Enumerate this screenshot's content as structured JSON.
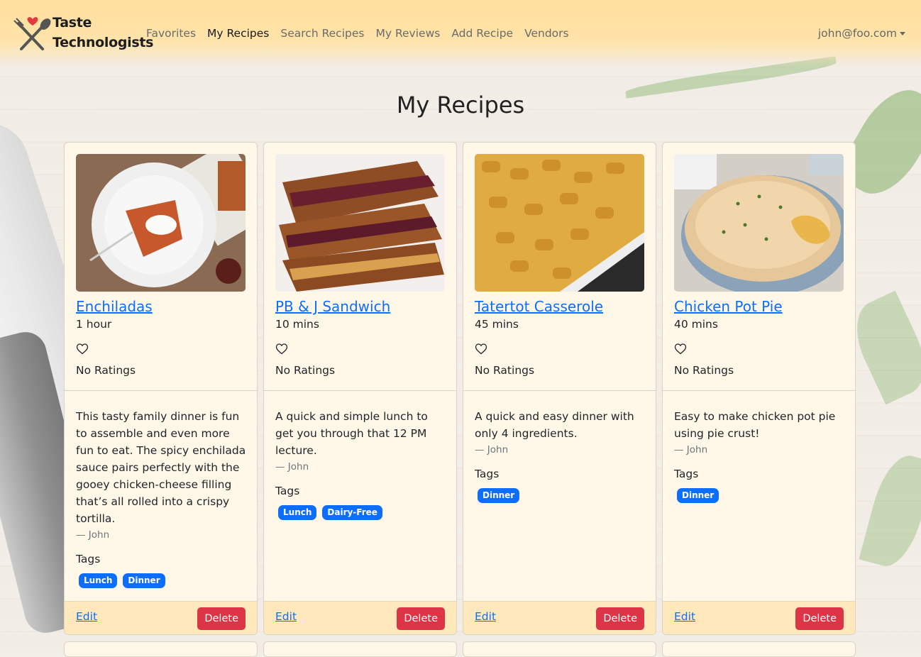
{
  "brand": {
    "line1": "Taste",
    "line2": "Technologists"
  },
  "nav": {
    "links": [
      "Favorites",
      "My Recipes",
      "Search Recipes",
      "My Reviews",
      "Add Recipe",
      "Vendors"
    ],
    "active": "My Recipes",
    "user_email": "john@foo.com"
  },
  "page_title": "My Recipes",
  "tags_label": "Tags",
  "edit_label": "Edit",
  "delete_label": "Delete",
  "colors": {
    "navbar": "#ffdf9e",
    "card": "#fff8e9",
    "primary": "#0d6efd",
    "danger": "#dc3545"
  },
  "recipes": [
    {
      "title": "Enchiladas",
      "time": "1 hour",
      "rating": "No Ratings",
      "description": "This tasty family dinner is fun to assemble and even more fun to eat. The spicy enchilada sauce pairs perfectly with the gooey chicken-cheese filling that’s all rolled into a crispy tortilla.",
      "author": "— John",
      "tags": [
        "Lunch",
        "Dinner"
      ]
    },
    {
      "title": "PB & J Sandwich",
      "time": "10 mins",
      "rating": "No Ratings",
      "description": "A quick and simple lunch to get you through that 12 PM lecture.",
      "author": "— John",
      "tags": [
        "Lunch",
        "Dairy-Free"
      ]
    },
    {
      "title": "Tatertot Casserole",
      "time": "45 mins",
      "rating": "No Ratings",
      "description": "A quick and easy dinner with only 4 ingredients.",
      "author": "— John",
      "tags": [
        "Dinner"
      ]
    },
    {
      "title": "Chicken Pot Pie",
      "time": "40 mins",
      "rating": "No Ratings",
      "description": "Easy to make chicken pot pie using pie crust!",
      "author": "— John",
      "tags": [
        "Dinner"
      ]
    }
  ]
}
